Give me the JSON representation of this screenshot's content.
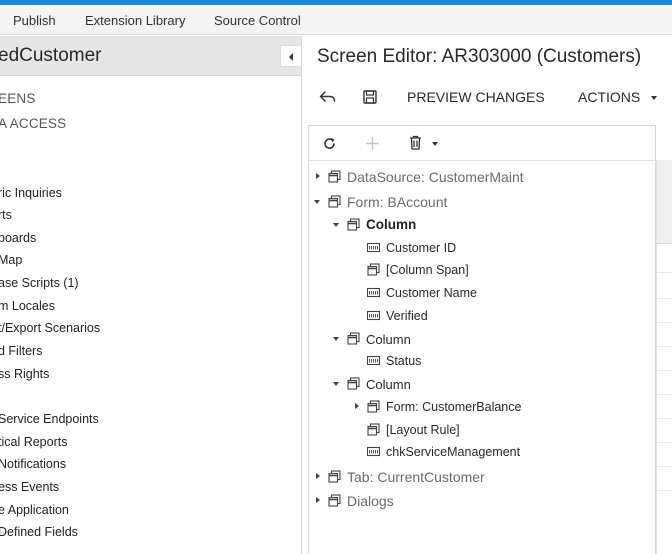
{
  "menubar": {
    "items": [
      "Publish",
      "Extension Library",
      "Source Control"
    ]
  },
  "left_panel": {
    "title": "edCustomer",
    "collapse_icon": "chevron-left-icon",
    "items": [
      "EENS",
      "A ACCESS",
      "ric Inquiries",
      "rts",
      "boards",
      "Map",
      "ase Scripts (1)",
      "m Locales",
      "t/Export Scenarios",
      "d Filters",
      "ss Rights",
      "Service Endpoints",
      "tical Reports",
      "Notifications",
      "ess Events",
      "e Application",
      "Defined Fields"
    ]
  },
  "editor": {
    "title": "Screen Editor: AR303000 (Customers)",
    "toolbar": {
      "undo_icon": "undo-icon",
      "save_icon": "save-icon",
      "preview_label": "PREVIEW CHANGES",
      "actions_label": "ACTIONS"
    },
    "tree_toolbar": {
      "refresh_icon": "refresh-icon",
      "add_icon": "plus-icon",
      "delete_icon": "trash-icon"
    },
    "tree": [
      {
        "label": "DataSource: CustomerMaint"
      },
      {
        "label": "Form: BAccount"
      },
      {
        "label": "Column"
      },
      {
        "label": "Customer ID"
      },
      {
        "label": "[Column Span]"
      },
      {
        "label": "Customer Name"
      },
      {
        "label": "Verified"
      },
      {
        "label": "Column"
      },
      {
        "label": "Status"
      },
      {
        "label": "Column"
      },
      {
        "label": "Form: CustomerBalance"
      },
      {
        "label": "[Layout Rule]"
      },
      {
        "label": "chkServiceManagement"
      },
      {
        "label": "Tab: CurrentCustomer"
      },
      {
        "label": "Dialogs"
      }
    ]
  },
  "colors": {
    "accent": "#1f88d6",
    "menubar_bg": "#f3f3f3",
    "header_bg": "#e6e6e6"
  }
}
